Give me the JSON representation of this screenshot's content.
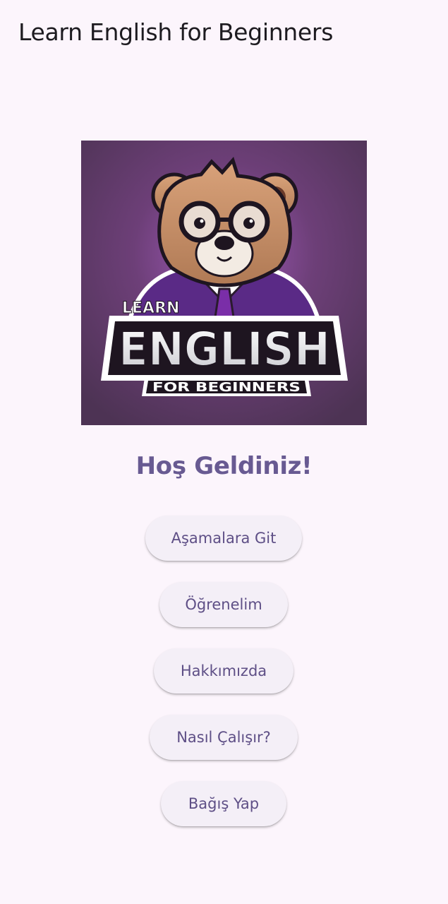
{
  "app_bar": {
    "title": "Learn English for Beginners"
  },
  "logo": {
    "text_small": "LEARN",
    "text_big": "ENGLISH",
    "text_sub": "FOR BEGINNERS"
  },
  "main": {
    "welcome": "Hoş Geldiniz!",
    "buttons": [
      {
        "label": "Aşamalara Git"
      },
      {
        "label": "Öğrenelim"
      },
      {
        "label": "Hakkımızda"
      },
      {
        "label": "Nasıl Çalışır?"
      },
      {
        "label": "Bağış Yap"
      }
    ]
  },
  "colors": {
    "background": "#fcf5fc",
    "accent": "#685a92",
    "button_bg": "#f4eff7",
    "logo_bg": "#5e3c66"
  }
}
